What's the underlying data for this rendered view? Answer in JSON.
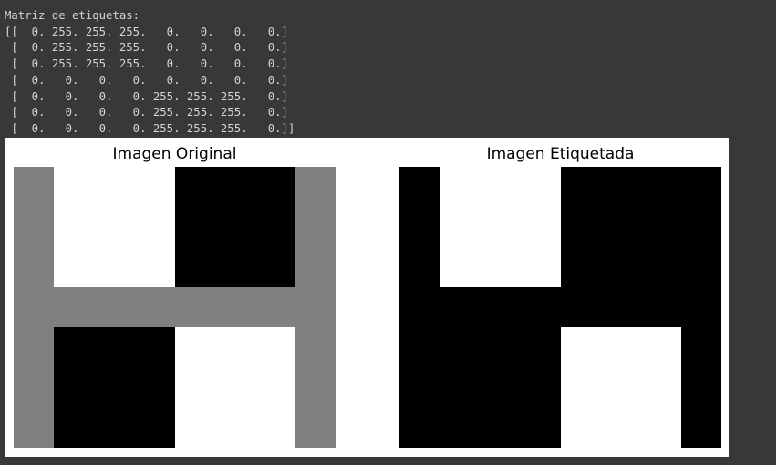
{
  "output": {
    "header": "Matriz de etiquetas:",
    "matrix_lines": [
      "[[  0. 255. 255. 255.   0.   0.   0.   0.]",
      " [  0. 255. 255. 255.   0.   0.   0.   0.]",
      " [  0. 255. 255. 255.   0.   0.   0.   0.]",
      " [  0.   0.   0.   0.   0.   0.   0.   0.]",
      " [  0.   0.   0.   0. 255. 255. 255.   0.]",
      " [  0.   0.   0.   0. 255. 255. 255.   0.]",
      " [  0.   0.   0.   0. 255. 255. 255.   0.]]"
    ]
  },
  "figure": {
    "background": "#ffffff",
    "subplots": [
      {
        "title": "Imagen Original",
        "cmap": "gray",
        "grid": [
          [
            128,
            255,
            255,
            255,
            0,
            0,
            0,
            128
          ],
          [
            128,
            255,
            255,
            255,
            0,
            0,
            0,
            128
          ],
          [
            128,
            255,
            255,
            255,
            0,
            0,
            0,
            128
          ],
          [
            128,
            128,
            128,
            128,
            128,
            128,
            128,
            128
          ],
          [
            128,
            0,
            0,
            0,
            255,
            255,
            255,
            128
          ],
          [
            128,
            0,
            0,
            0,
            255,
            255,
            255,
            128
          ],
          [
            128,
            0,
            0,
            0,
            255,
            255,
            255,
            128
          ]
        ]
      },
      {
        "title": "Imagen Etiquetada",
        "cmap": "gray",
        "grid": [
          [
            0,
            255,
            255,
            255,
            0,
            0,
            0,
            0
          ],
          [
            0,
            255,
            255,
            255,
            0,
            0,
            0,
            0
          ],
          [
            0,
            255,
            255,
            255,
            0,
            0,
            0,
            0
          ],
          [
            0,
            0,
            0,
            0,
            0,
            0,
            0,
            0
          ],
          [
            0,
            0,
            0,
            0,
            255,
            255,
            255,
            0
          ],
          [
            0,
            0,
            0,
            0,
            255,
            255,
            255,
            0
          ],
          [
            0,
            0,
            0,
            0,
            255,
            255,
            255,
            0
          ]
        ]
      }
    ]
  }
}
